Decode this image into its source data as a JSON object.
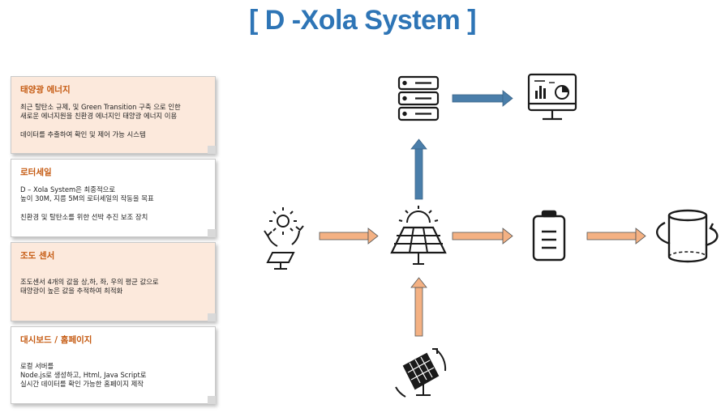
{
  "title": "[ D -Xola System ]",
  "notes": [
    {
      "heading": "태양광 에너지",
      "line1": "최근 탈탄소 규제, 및 Green Transition 구축 으로 인한",
      "line2": "새로운 에너지원을 친환경 에너지인 태양광 에너지 이용",
      "line3": "데이터를 추출하여 확인 및 제어 가능 시스템"
    },
    {
      "heading": "로터세일",
      "line1": "D – Xola System은 최종적으로",
      "line2": "높이 30M, 지름 5M의 로터세일의 작동을 목표",
      "line3": "친환경 및 탈탄소를 위한 선박 추진 보조 장치"
    },
    {
      "heading": "조도 센서",
      "line1": "조도센서 4개의 값을 상,하, 좌, 우의 평균 값으로",
      "line2": "태양광이 높은 값을 추적하여 최적화"
    },
    {
      "heading": "대시보드 / 홈페이지",
      "line1": "로컬 서버를",
      "line2": "Node.js로 생성하고, Html, Java Script로",
      "line3": "실시간 데이터를 확인 가능한 홈페이지 제작"
    }
  ],
  "icons": [
    "sun-tracking-icon",
    "solar-panel-icon",
    "server-icon",
    "dashboard-monitor-icon",
    "battery-icon",
    "rotor-sail-icon",
    "rotating-solar-panel-icon"
  ],
  "colors": {
    "title": "#2E75B6",
    "heading": "#C55A11",
    "arrow_blue": "#4A7EAA",
    "arrow_orange": "#F4B183",
    "note_fill": "#FCE9DC",
    "icon_stroke": "#1a1a1a"
  }
}
